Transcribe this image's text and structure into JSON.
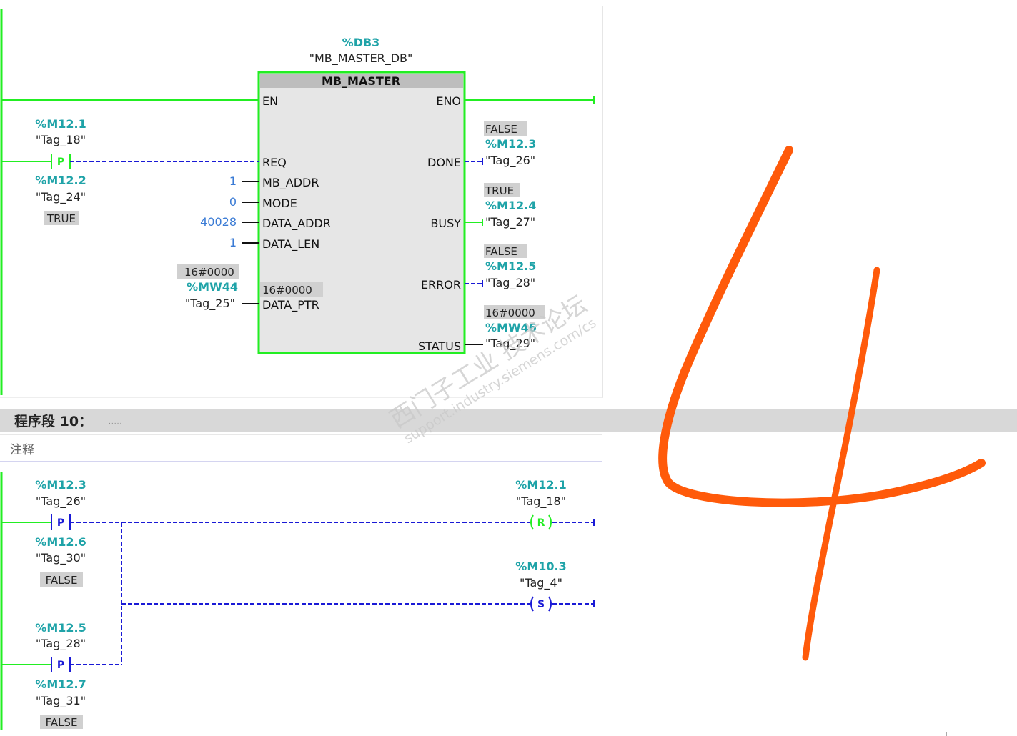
{
  "network9": {
    "instance_db": {
      "address": "%DB3",
      "name": "\"MB_MASTER_DB\""
    },
    "block": {
      "title": "MB_MASTER",
      "inputs": {
        "en": "EN",
        "req": "REQ",
        "mb_addr": "MB_ADDR",
        "mode": "MODE",
        "data_addr": "DATA_ADDR",
        "data_len": "DATA_LEN",
        "data_ptr": "DATA_PTR"
      },
      "outputs": {
        "eno": "ENO",
        "done": "DONE",
        "busy": "BUSY",
        "error": "ERROR",
        "status": "STATUS"
      },
      "data_ptr_value": "16#0000"
    },
    "req_contact": {
      "address": "%M12.1",
      "tag": "\"Tag_18\"",
      "symbol": "P",
      "edge_address": "%M12.2",
      "edge_tag": "\"Tag_24\"",
      "edge_value": "TRUE"
    },
    "params": {
      "mb_addr": "1",
      "mode": "0",
      "data_addr": "40028",
      "data_len": "1"
    },
    "data_ptr_param": {
      "value": "16#0000",
      "address": "%MW44",
      "tag": "\"Tag_25\""
    },
    "done_out": {
      "value": "FALSE",
      "address": "%M12.3",
      "tag": "\"Tag_26\""
    },
    "busy_out": {
      "value": "TRUE",
      "address": "%M12.4",
      "tag": "\"Tag_27\""
    },
    "error_out": {
      "value": "FALSE",
      "address": "%M12.5",
      "tag": "\"Tag_28\""
    },
    "status_out": {
      "value": "16#0000",
      "address": "%MW46",
      "tag": "\"Tag_29\""
    }
  },
  "network10": {
    "title": "程序段 10：",
    "dots": ".....",
    "comment": "注释",
    "contact1": {
      "address": "%M12.3",
      "tag": "\"Tag_26\"",
      "symbol": "P",
      "edge_address": "%M12.6",
      "edge_tag": "\"Tag_30\"",
      "edge_value": "FALSE"
    },
    "contact2": {
      "address": "%M12.5",
      "tag": "\"Tag_28\"",
      "symbol": "P",
      "edge_address": "%M12.7",
      "edge_tag": "\"Tag_31\"",
      "edge_value": "FALSE"
    },
    "coil_reset": {
      "address": "%M12.1",
      "tag": "\"Tag_18\"",
      "symbol": "R"
    },
    "coil_set": {
      "address": "%M10.3",
      "tag": "\"Tag_4\"",
      "symbol": "S"
    }
  },
  "watermark": {
    "line1": "西门子工业 技术论坛",
    "line2": "support.industry.siemens.com/cs"
  },
  "colors": {
    "energized": "#22ee22",
    "not_energized": "#1a1ad6",
    "address": "#1fa3a8",
    "constant": "#3a7bd5",
    "annotation": "#ff5a0a"
  }
}
